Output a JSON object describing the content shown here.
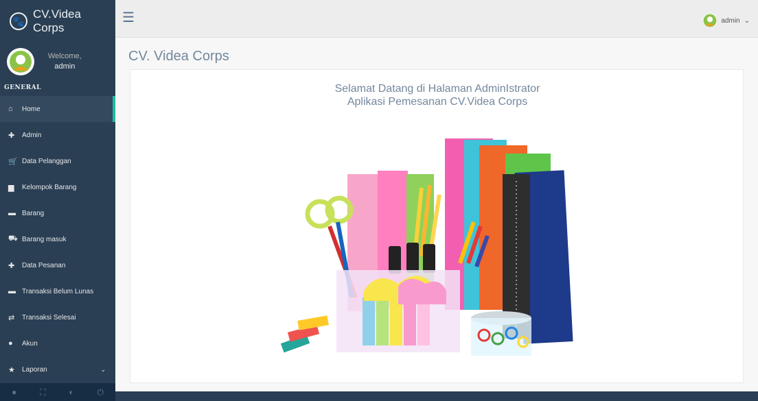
{
  "brand": {
    "title": "CV.Videa Corps",
    "icon": "paw-icon"
  },
  "profile": {
    "welcome": "Welcome,",
    "name": "admin"
  },
  "sidebar": {
    "section": "GENERAL",
    "items": [
      {
        "label": "Home",
        "icon": "home-icon",
        "glyph": "⌂",
        "active": true
      },
      {
        "label": "Admin",
        "icon": "plus-icon",
        "glyph": "✚"
      },
      {
        "label": "Data Pelanggan",
        "icon": "cart-icon",
        "glyph": "🛒"
      },
      {
        "label": "Kelompok Barang",
        "icon": "briefcase-icon",
        "glyph": "▆"
      },
      {
        "label": "Barang",
        "icon": "truck-icon",
        "glyph": "▬"
      },
      {
        "label": "Barang masuk",
        "icon": "cart-arrow-icon",
        "glyph": "⛟"
      },
      {
        "label": "Data Pesanan",
        "icon": "plus-icon",
        "glyph": "✚"
      },
      {
        "label": "Transaksi Belum Lunas",
        "icon": "minus-icon",
        "glyph": "▬"
      },
      {
        "label": "Transaksi Selesai",
        "icon": "retweet-icon",
        "glyph": "⇄"
      },
      {
        "label": "Akun",
        "icon": "user-icon",
        "glyph": "●"
      },
      {
        "label": "Laporan",
        "icon": "star-icon",
        "glyph": "★",
        "has_children": true
      }
    ],
    "footer_icons": [
      "user-icon",
      "fullscreen-icon",
      "eye-slash-icon",
      "power-off-icon"
    ]
  },
  "topnav": {
    "user": "admin",
    "toggle_icon": "hamburger-menu-icon"
  },
  "main": {
    "title": "CV. Videa Corps",
    "welcome_line1": "Selamat Datang di Halaman AdminIstrator",
    "welcome_line2": "Aplikasi Pemesanan CV.Videa Corps"
  },
  "colors": {
    "sidebar": "#2A3F54",
    "accent": "#1ABB9C",
    "topnav": "#EDEDED",
    "background": "#F7F7F7"
  }
}
